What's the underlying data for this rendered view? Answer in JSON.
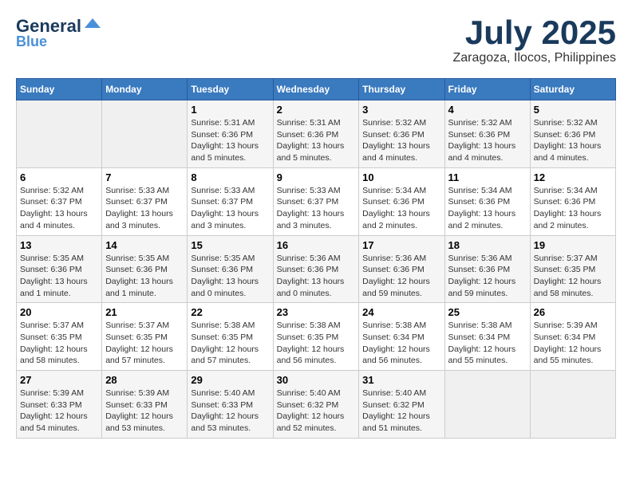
{
  "header": {
    "logo_general": "General",
    "logo_blue": "Blue",
    "month_title": "July 2025",
    "location": "Zaragoza, Ilocos, Philippines"
  },
  "weekdays": [
    "Sunday",
    "Monday",
    "Tuesday",
    "Wednesday",
    "Thursday",
    "Friday",
    "Saturday"
  ],
  "weeks": [
    [
      {
        "day": "",
        "info": ""
      },
      {
        "day": "",
        "info": ""
      },
      {
        "day": "1",
        "info": "Sunrise: 5:31 AM\nSunset: 6:36 PM\nDaylight: 13 hours and 5 minutes."
      },
      {
        "day": "2",
        "info": "Sunrise: 5:31 AM\nSunset: 6:36 PM\nDaylight: 13 hours and 5 minutes."
      },
      {
        "day": "3",
        "info": "Sunrise: 5:32 AM\nSunset: 6:36 PM\nDaylight: 13 hours and 4 minutes."
      },
      {
        "day": "4",
        "info": "Sunrise: 5:32 AM\nSunset: 6:36 PM\nDaylight: 13 hours and 4 minutes."
      },
      {
        "day": "5",
        "info": "Sunrise: 5:32 AM\nSunset: 6:36 PM\nDaylight: 13 hours and 4 minutes."
      }
    ],
    [
      {
        "day": "6",
        "info": "Sunrise: 5:32 AM\nSunset: 6:37 PM\nDaylight: 13 hours and 4 minutes."
      },
      {
        "day": "7",
        "info": "Sunrise: 5:33 AM\nSunset: 6:37 PM\nDaylight: 13 hours and 3 minutes."
      },
      {
        "day": "8",
        "info": "Sunrise: 5:33 AM\nSunset: 6:37 PM\nDaylight: 13 hours and 3 minutes."
      },
      {
        "day": "9",
        "info": "Sunrise: 5:33 AM\nSunset: 6:37 PM\nDaylight: 13 hours and 3 minutes."
      },
      {
        "day": "10",
        "info": "Sunrise: 5:34 AM\nSunset: 6:36 PM\nDaylight: 13 hours and 2 minutes."
      },
      {
        "day": "11",
        "info": "Sunrise: 5:34 AM\nSunset: 6:36 PM\nDaylight: 13 hours and 2 minutes."
      },
      {
        "day": "12",
        "info": "Sunrise: 5:34 AM\nSunset: 6:36 PM\nDaylight: 13 hours and 2 minutes."
      }
    ],
    [
      {
        "day": "13",
        "info": "Sunrise: 5:35 AM\nSunset: 6:36 PM\nDaylight: 13 hours and 1 minute."
      },
      {
        "day": "14",
        "info": "Sunrise: 5:35 AM\nSunset: 6:36 PM\nDaylight: 13 hours and 1 minute."
      },
      {
        "day": "15",
        "info": "Sunrise: 5:35 AM\nSunset: 6:36 PM\nDaylight: 13 hours and 0 minutes."
      },
      {
        "day": "16",
        "info": "Sunrise: 5:36 AM\nSunset: 6:36 PM\nDaylight: 13 hours and 0 minutes."
      },
      {
        "day": "17",
        "info": "Sunrise: 5:36 AM\nSunset: 6:36 PM\nDaylight: 12 hours and 59 minutes."
      },
      {
        "day": "18",
        "info": "Sunrise: 5:36 AM\nSunset: 6:36 PM\nDaylight: 12 hours and 59 minutes."
      },
      {
        "day": "19",
        "info": "Sunrise: 5:37 AM\nSunset: 6:35 PM\nDaylight: 12 hours and 58 minutes."
      }
    ],
    [
      {
        "day": "20",
        "info": "Sunrise: 5:37 AM\nSunset: 6:35 PM\nDaylight: 12 hours and 58 minutes."
      },
      {
        "day": "21",
        "info": "Sunrise: 5:37 AM\nSunset: 6:35 PM\nDaylight: 12 hours and 57 minutes."
      },
      {
        "day": "22",
        "info": "Sunrise: 5:38 AM\nSunset: 6:35 PM\nDaylight: 12 hours and 57 minutes."
      },
      {
        "day": "23",
        "info": "Sunrise: 5:38 AM\nSunset: 6:35 PM\nDaylight: 12 hours and 56 minutes."
      },
      {
        "day": "24",
        "info": "Sunrise: 5:38 AM\nSunset: 6:34 PM\nDaylight: 12 hours and 56 minutes."
      },
      {
        "day": "25",
        "info": "Sunrise: 5:38 AM\nSunset: 6:34 PM\nDaylight: 12 hours and 55 minutes."
      },
      {
        "day": "26",
        "info": "Sunrise: 5:39 AM\nSunset: 6:34 PM\nDaylight: 12 hours and 55 minutes."
      }
    ],
    [
      {
        "day": "27",
        "info": "Sunrise: 5:39 AM\nSunset: 6:33 PM\nDaylight: 12 hours and 54 minutes."
      },
      {
        "day": "28",
        "info": "Sunrise: 5:39 AM\nSunset: 6:33 PM\nDaylight: 12 hours and 53 minutes."
      },
      {
        "day": "29",
        "info": "Sunrise: 5:40 AM\nSunset: 6:33 PM\nDaylight: 12 hours and 53 minutes."
      },
      {
        "day": "30",
        "info": "Sunrise: 5:40 AM\nSunset: 6:32 PM\nDaylight: 12 hours and 52 minutes."
      },
      {
        "day": "31",
        "info": "Sunrise: 5:40 AM\nSunset: 6:32 PM\nDaylight: 12 hours and 51 minutes."
      },
      {
        "day": "",
        "info": ""
      },
      {
        "day": "",
        "info": ""
      }
    ]
  ]
}
